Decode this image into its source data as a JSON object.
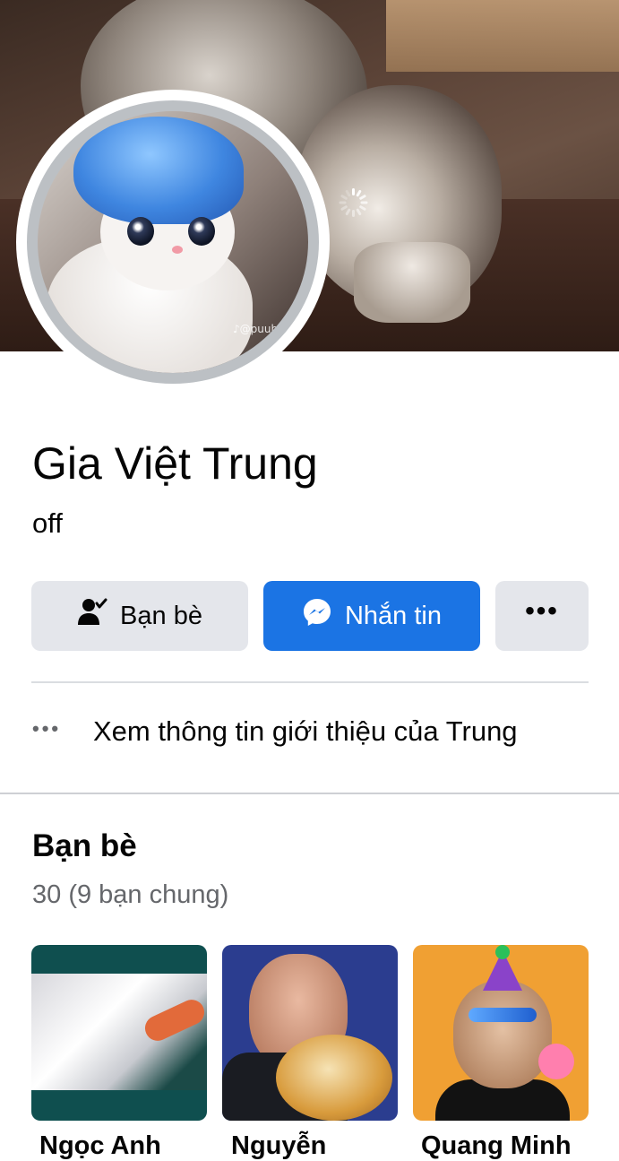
{
  "profile": {
    "name": "Gia Việt Trung",
    "bio": "off",
    "avatar_watermark": "♪@puub"
  },
  "actions": {
    "friends_label": "Bạn bè",
    "message_label": "Nhắn tin",
    "more_label": "•••"
  },
  "about": {
    "label": "Xem thông tin giới thiệu của Trung",
    "dots": "•••"
  },
  "friends": {
    "title": "Bạn bè",
    "count": "30 (9 bạn chung)",
    "items": [
      {
        "name": "Ngọc Anh"
      },
      {
        "name": "Nguyễn"
      },
      {
        "name": "Quang Minh"
      }
    ]
  },
  "colors": {
    "brand_blue": "#1b74e4",
    "button_gray": "#e4e6eb",
    "text_secondary": "#65676b"
  },
  "icons": {
    "friends_button": "person-check-icon",
    "message_button": "messenger-icon",
    "more_button": "more-dots-icon",
    "about_row": "more-dots-icon",
    "cover_loader": "loading-spinner-icon"
  }
}
